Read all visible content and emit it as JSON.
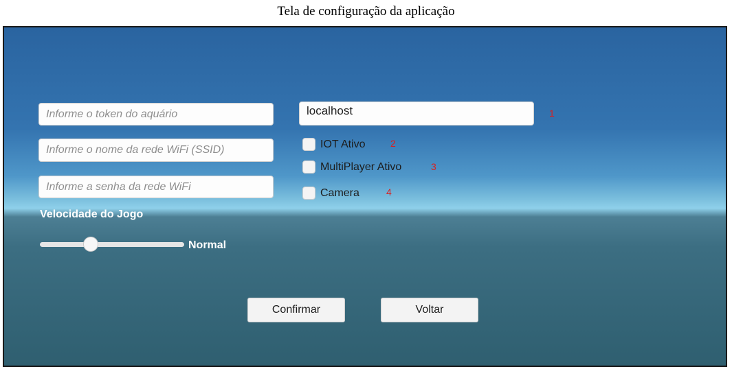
{
  "caption": "Tela de configuração da aplicação",
  "fields": {
    "token_placeholder": "Informe o token do aquário",
    "ssid_placeholder": "Informe o nome da rede WiFi (SSID)",
    "password_placeholder": "Informe a senha da rede WiFi",
    "host_value": "localhost"
  },
  "checkboxes": [
    {
      "label": "IOT Ativo",
      "checked": false
    },
    {
      "label": "MultiPlayer Ativo",
      "checked": false
    },
    {
      "label": "Camera",
      "checked": false
    }
  ],
  "markers": [
    "1",
    "2",
    "3",
    "4"
  ],
  "speed": {
    "label": "Velocidade do Jogo",
    "value_label": "Normal",
    "slider_value_fraction": 0.35
  },
  "buttons": {
    "confirm": "Confirmar",
    "back": "Voltar"
  },
  "colors": {
    "marker": "#d92020",
    "sky_top": "#2a64a0",
    "horizon": "#8fd0ea",
    "sea": "#2f5f70"
  }
}
